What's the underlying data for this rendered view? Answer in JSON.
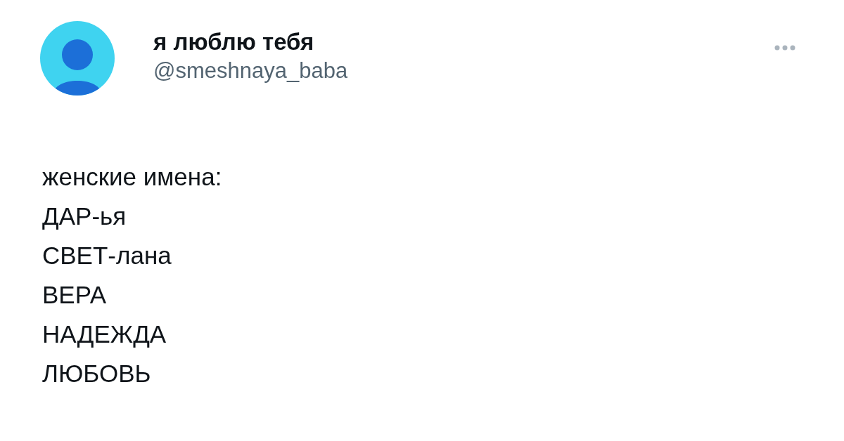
{
  "author": {
    "name": "я люблю тебя",
    "handle": "@smeshnaya_baba"
  },
  "body": [
    "женские имена:",
    "ДАР-ья",
    "СВЕТ-лана",
    "ВЕРА",
    "НАДЕЖДА",
    "ЛЮБОВЬ"
  ]
}
